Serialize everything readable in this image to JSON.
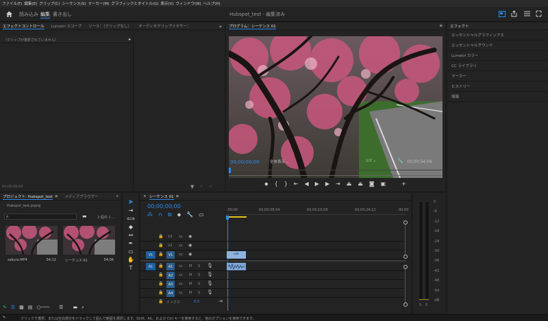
{
  "menu": [
    "ファイル(F)",
    "編集(E)",
    "クリップ(C)",
    "シーケンス(S)",
    "マーカー(M)",
    "グラフィックとタイトル(G)",
    "表示(V)",
    "ウィンドウ(W)",
    "ヘルプ(H)"
  ],
  "workspace_tabs": {
    "home": "home-icon",
    "import": "読み込み",
    "edit": "編集",
    "export": "書き出し"
  },
  "window_title": "Hubspot_test - 編集済み",
  "source_panel": {
    "tabs": [
      "エフェクトコントロール",
      "Lumetri スコープ",
      "ソース：（クリップなし）",
      "オーディオクリップミキサー："
    ],
    "no_clip": "（クリップが選択されていません）",
    "timecode": "00;00;00;00"
  },
  "program_panel": {
    "title": "プログラム：シーケンス 01",
    "timecode": "00;00;00;00",
    "fit": "全体表示",
    "quality": "1/2",
    "duration": "00;00;54;06"
  },
  "effects_panel": {
    "title": "エフェクト",
    "items": [
      "エッセンシャルグラフィックス",
      "エッセンシャルサウンド",
      "Lumetri カラー",
      "CC ライブラリ",
      "マーカー",
      "ヒストリー",
      "情報"
    ]
  },
  "project_panel": {
    "tabs": [
      "プロジェクト: Hubspot_test",
      "メディアブラウザー"
    ],
    "filename": "Hubspot_test.prproj",
    "selection": "2 個中 1 ...",
    "items": [
      {
        "name": "sakura.MP4",
        "duration": "54;12"
      },
      {
        "name": "シーケンス 01",
        "duration": "54;06"
      }
    ]
  },
  "timeline": {
    "title": "シーケンス 01",
    "timecode": "00;00;00;00",
    "ruler": [
      ":00;00",
      "00;00;08;04",
      "00;00;16;08",
      "00;00;24;12",
      "00;00"
    ],
    "video_tracks": [
      "V3",
      "V2",
      "V1"
    ],
    "audio_tracks": [
      "A1",
      "A2",
      "A3",
      "A4"
    ],
    "source_v": "V1",
    "source_a": "A1",
    "mix_label": "ミックス",
    "mix_value": "0.0",
    "clip_label": "sak"
  },
  "meter_labels": [
    "0",
    "-6",
    "-12",
    "-18",
    "-24",
    "-30",
    "-36",
    "-42",
    "-48",
    "-54",
    "-dB"
  ],
  "meter_solo": [
    "S",
    "S"
  ],
  "status_bar": "クリックで選択、または空白部分をドラッグして囲んで範囲を選択します。Shift、Alt、および Ctrl キーを使用すると、他のオプションを使用できます。",
  "colors": {
    "accent": "#2d8ceb",
    "clip_video": "#8db4e0",
    "bg": "#1d1d1d"
  }
}
